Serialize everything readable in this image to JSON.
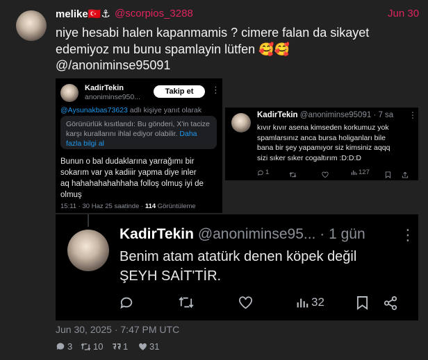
{
  "post": {
    "display_name": "melike🇹🇷⚓",
    "handle": "@scorpios_3288",
    "date": "Jun 30",
    "text_line1": "niye hesabi halen kapanmamis ?  cimere falan da sikayet",
    "text_line2": "edemiyoz mu bunu spamlayin lütfen 🥰🥰",
    "text_line3": "@/anoniminse95091",
    "timestamp": "Jun 30, 2025 · 7:47 PM UTC",
    "stats": {
      "comments": "3",
      "retweets": "10",
      "quotes": "1",
      "likes": "31"
    }
  },
  "embed1": {
    "name": "KadirTekin",
    "handle": "anoniminse950...",
    "follow_label": "Takip et",
    "more": "⋮",
    "reply_to": "@Aysunakbas73623",
    "reply_suffix": " adlı kişiye yanıt olarak",
    "notice_line1": "Görünürlük kısıtlandı: Bu gönderi, X'in tacize",
    "notice_line2": "karşı kurallarını ihlal ediyor olabilir.",
    "notice_link1": " Daha",
    "notice_link2": "fazla bilgi al",
    "text_line1": "Bunun o bal dudaklarına yarrağımı bir",
    "text_line2": "sokarım var ya kadiiir yapma diye inler",
    "text_line3": "aq hahahahahahhaha folloş olmuş iyi de",
    "text_line4": "olmuş",
    "meta_time": "15:11 · 30 Haz 25 saatinde · ",
    "meta_views": "114",
    "meta_views_label": " Görüntüleme"
  },
  "embed2": {
    "name": "KadirTekin",
    "handle": "@anoniminse95091 · 7 sa",
    "more": "⋮",
    "text_line1": "kıvır kıvır asena kimseden korkumuz yok",
    "text_line2": "spamlarsınız anca bursa holiganları bile",
    "text_line3": "bana bir şey yapamıyor siz kimsiniz aqqq",
    "text_line4": "sizi sıker sıker cogaltırım :D:D:D",
    "replies": "1",
    "views": "127"
  },
  "embed3": {
    "name": "KadirTekin",
    "handle": "@anoniminse95...",
    "time": "· 1 gün",
    "more": "⋮",
    "text_line1": "Benim atam atatürk denen köpek değil",
    "text_line2": "ŞEYH SAİT'TİR.",
    "views": "32"
  },
  "colors": {
    "background": "#222222",
    "accent_red": "#e0245e",
    "link_blue": "#1d9bf0"
  }
}
